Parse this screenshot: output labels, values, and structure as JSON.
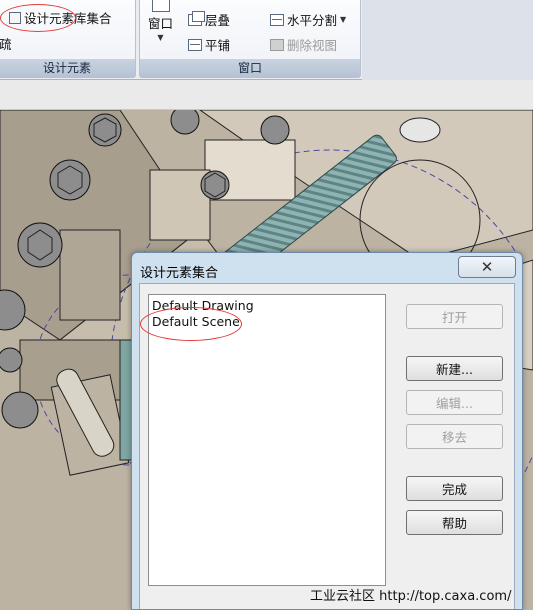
{
  "ribbon": {
    "design_group": {
      "library_button": "设计元素库集合",
      "cut_text": "疏",
      "label": "设计元素"
    },
    "window_group": {
      "window_button": "窗口",
      "cascade": "层叠",
      "tile": "平铺",
      "split_horizontal": "水平分割",
      "delete_view": "删除视图",
      "label": "窗口"
    }
  },
  "dialog": {
    "title": "设计元素集合",
    "close_glyph": "✕",
    "list_items": [
      "Default Drawing",
      "Default Scene"
    ],
    "buttons": {
      "open": "打开",
      "new": "新建...",
      "edit": "编辑...",
      "remove": "移去",
      "done": "完成",
      "help": "帮助"
    }
  },
  "watermark": "工业云社区 http://top.caxa.com/",
  "colors": {
    "ribbon_bg": "#e9ecf1",
    "dialog_frame": "#cfe0ef",
    "highlight": "#e43b3b",
    "spring": "#8fb3b2"
  },
  "icons": [
    "design-library-icon",
    "window-icon",
    "cascade-icon",
    "tile-icon",
    "split-horizontal-icon",
    "delete-view-icon",
    "close-icon"
  ]
}
